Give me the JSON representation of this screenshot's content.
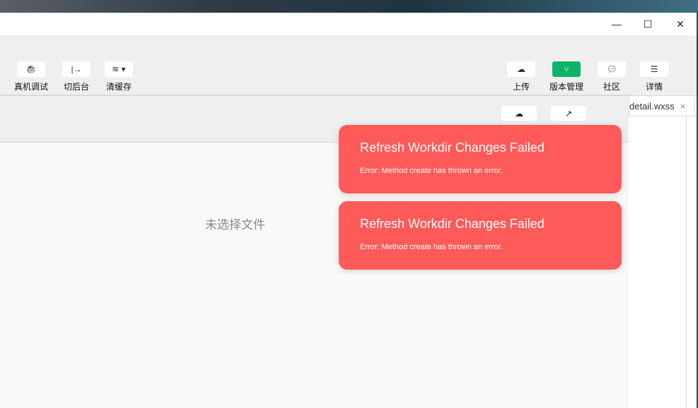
{
  "window_controls": {
    "minimize": "—",
    "maximize": "☐",
    "close": "✕"
  },
  "toolbar": {
    "left": [
      {
        "label": "真机调试",
        "icon": "bug-icon",
        "glyph": "🐞︎"
      },
      {
        "label": "切后台",
        "icon": "switch-background-icon",
        "glyph": "|→"
      },
      {
        "label": "清缓存",
        "icon": "layers-icon",
        "glyph": "≋ ▾"
      }
    ],
    "right": [
      {
        "label": "上传",
        "icon": "cloud-upload-icon",
        "glyph": "☁"
      },
      {
        "label": "版本管理",
        "icon": "git-branch-icon",
        "glyph": "⑂"
      },
      {
        "label": "社区",
        "icon": "chat-bubble-icon",
        "glyph": "💬︎"
      },
      {
        "label": "详情",
        "icon": "menu-icon",
        "glyph": "☰"
      }
    ]
  },
  "subbar": {
    "upload_glyph": "☁",
    "open_external_glyph": "↗"
  },
  "editor": {
    "empty_text": "未选择文件",
    "tab_label": "detail.wxss",
    "tab_close": "×"
  },
  "toasts": [
    {
      "title": "Refresh Workdir Changes Failed",
      "message": "Error: Method create has thrown an error."
    },
    {
      "title": "Refresh Workdir Changes Failed",
      "message": "Error: Method create has thrown an error."
    }
  ],
  "colors": {
    "toast": "#ff5a5a",
    "accent_green": "#0db368"
  }
}
